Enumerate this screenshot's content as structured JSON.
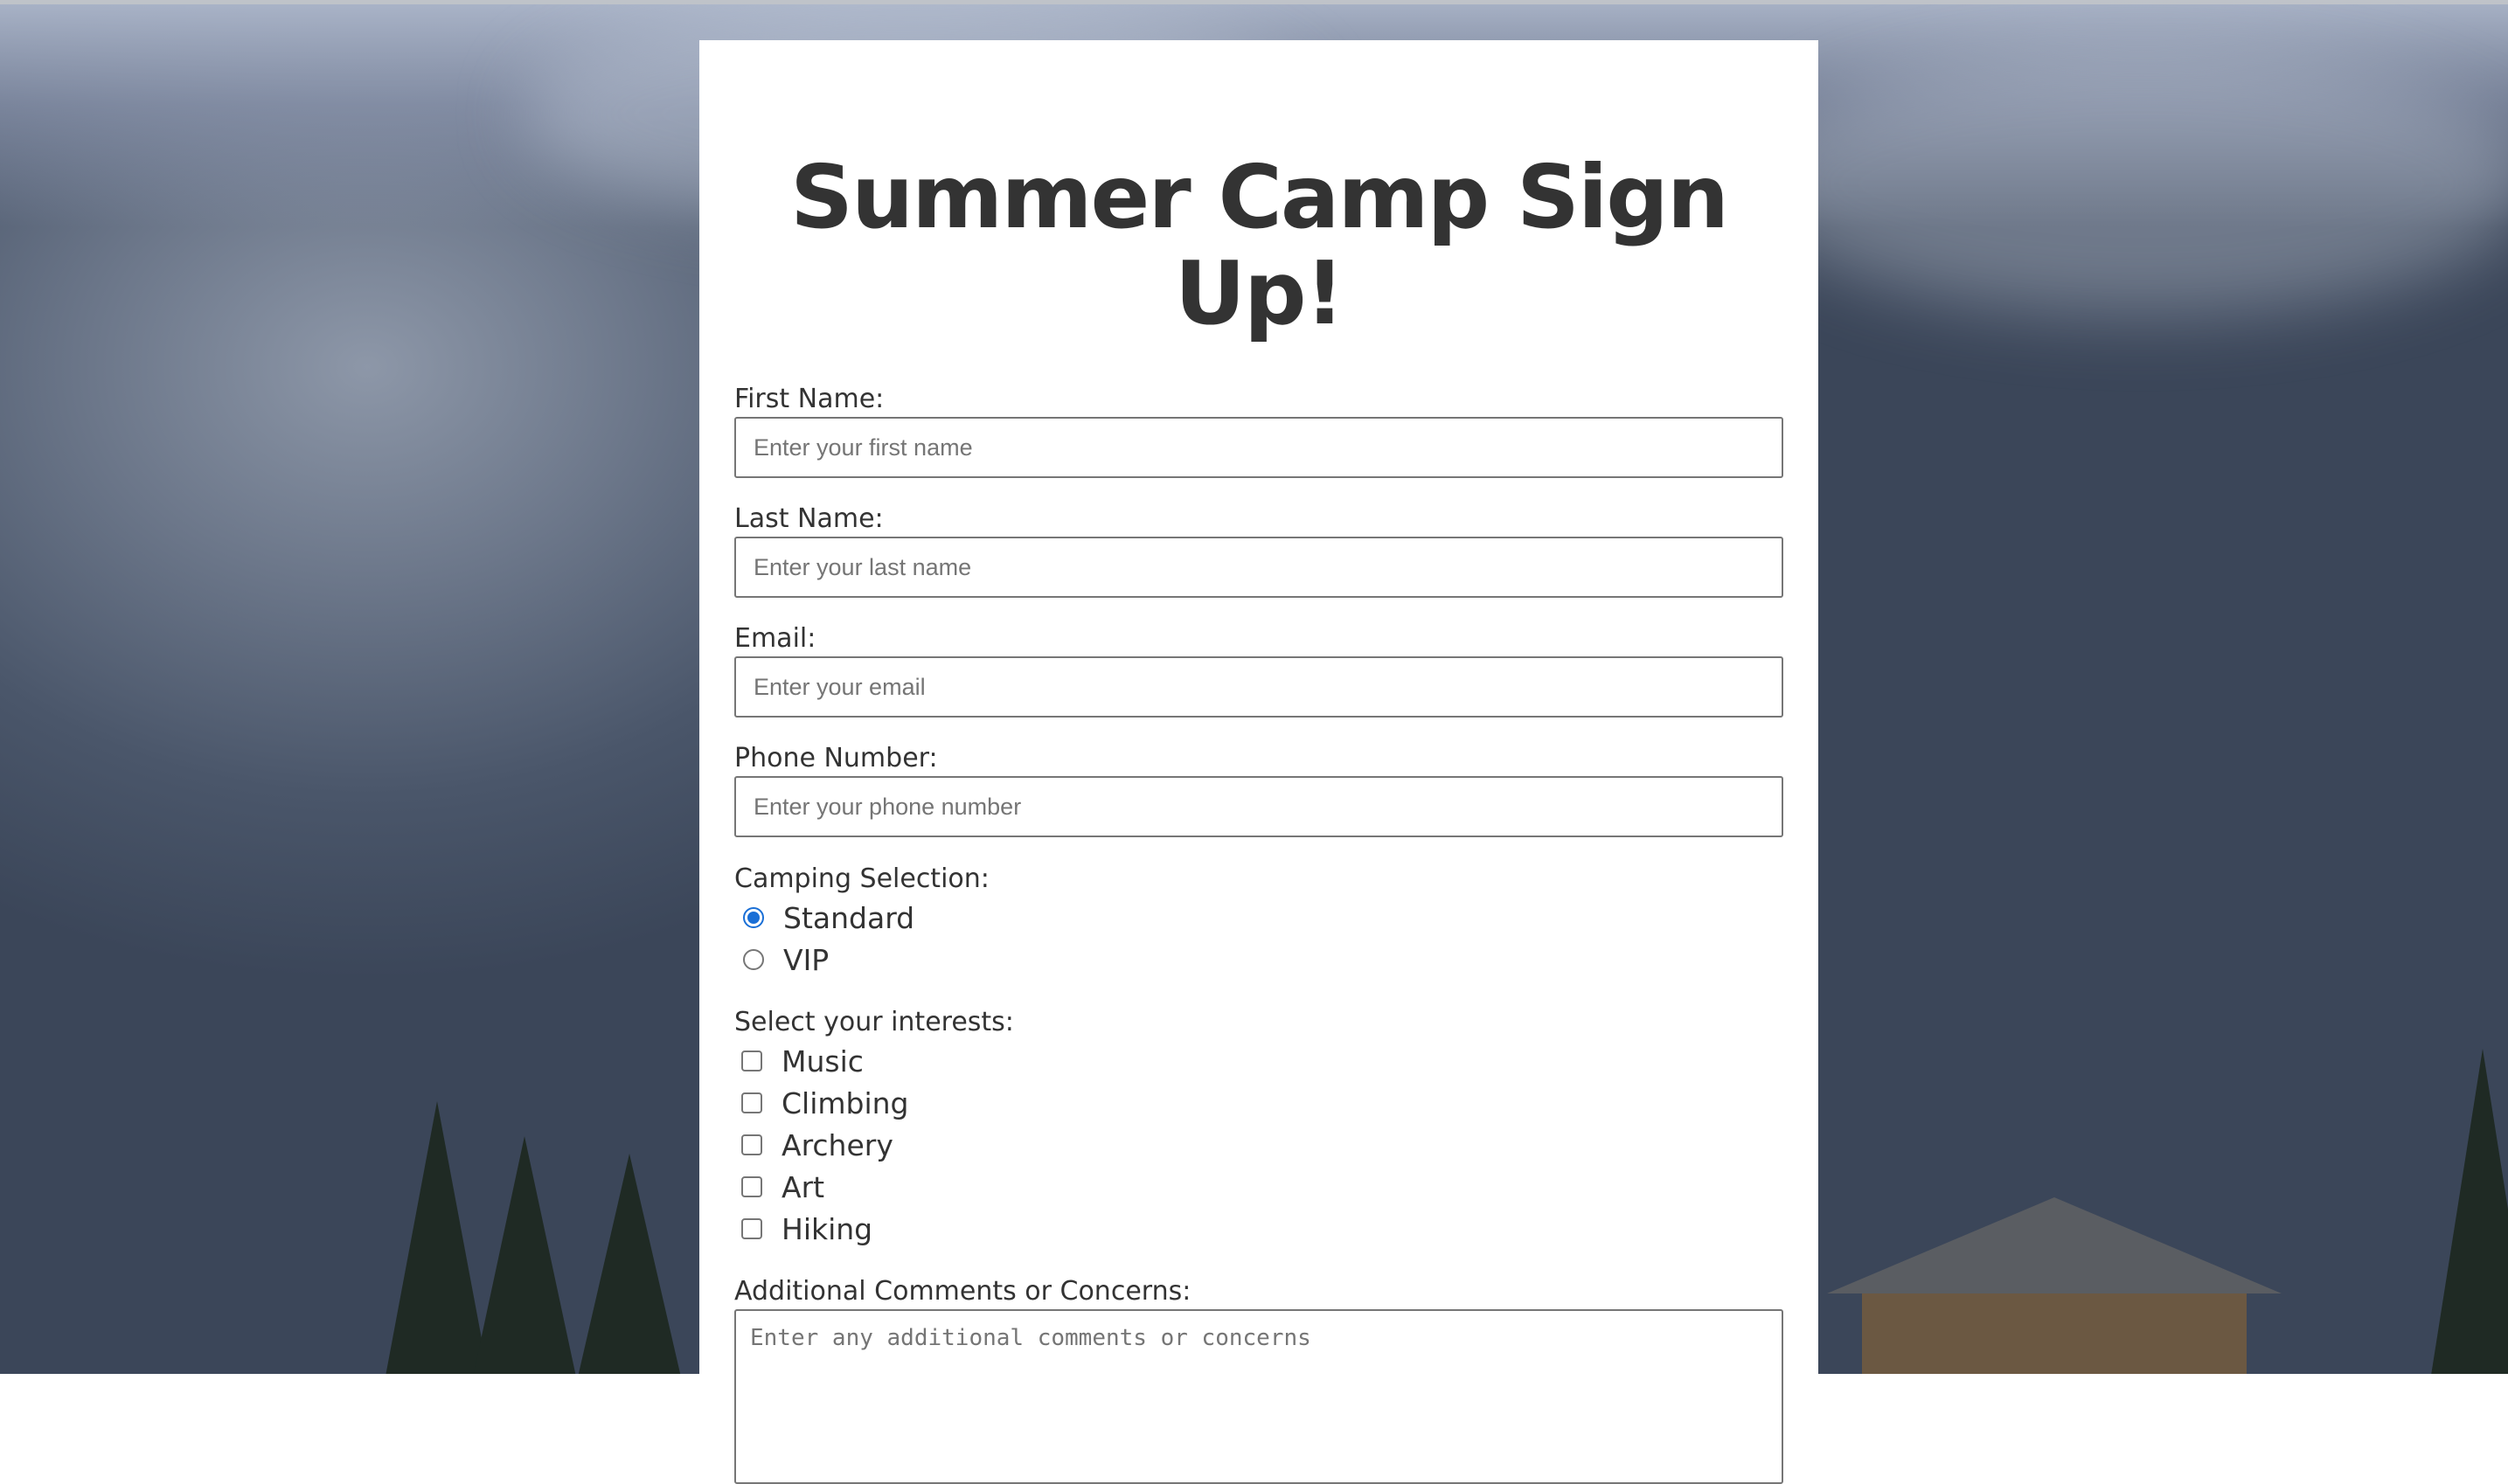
{
  "page": {
    "title": "Summer Camp Sign Up!"
  },
  "form": {
    "first_name": {
      "label": "First Name:",
      "placeholder": "Enter your first name",
      "value": ""
    },
    "last_name": {
      "label": "Last Name:",
      "placeholder": "Enter your last name",
      "value": ""
    },
    "email": {
      "label": "Email:",
      "placeholder": "Enter your email",
      "value": ""
    },
    "phone": {
      "label": "Phone Number:",
      "placeholder": "Enter your phone number",
      "value": ""
    },
    "camping": {
      "label": "Camping Selection:",
      "options": [
        {
          "label": "Standard",
          "checked": true
        },
        {
          "label": "VIP",
          "checked": false
        }
      ]
    },
    "interests": {
      "label": "Select your interests:",
      "options": [
        {
          "label": "Music",
          "checked": false
        },
        {
          "label": "Climbing",
          "checked": false
        },
        {
          "label": "Archery",
          "checked": false
        },
        {
          "label": "Art",
          "checked": false
        },
        {
          "label": "Hiking",
          "checked": false
        }
      ]
    },
    "comments": {
      "label": "Additional Comments or Concerns:",
      "placeholder": "Enter any additional comments or concerns"
    }
  },
  "colors": {
    "accent": "#1a6fd6",
    "text": "#333333",
    "card_background": "#ffffff"
  },
  "background": {
    "icon": "mountain-landscape-background"
  }
}
